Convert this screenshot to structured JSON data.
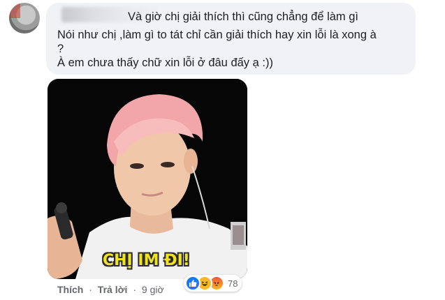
{
  "comment": {
    "lines": [
      "Và giờ chị giải thích thì cũng chẳng để làm gì",
      "Nói như chị ,làm gì to tát chỉ cần giải thích hay xin lỗi là xong à",
      "?",
      "À em chưa thấy chữ xin lỗi ở đâu đấy ạ :))"
    ]
  },
  "meme": {
    "caption": "CHỊ IM ĐI!"
  },
  "actions": {
    "like_label": "Thích",
    "reply_label": "Trả lời",
    "separator": "·",
    "time": "9 giờ"
  },
  "reactions": {
    "icons": [
      "like-icon",
      "haha-icon",
      "angry-icon"
    ],
    "colors": {
      "like": "#1877f2",
      "haha": "#f7b928",
      "angry": "#e9710f"
    },
    "count": "78"
  }
}
